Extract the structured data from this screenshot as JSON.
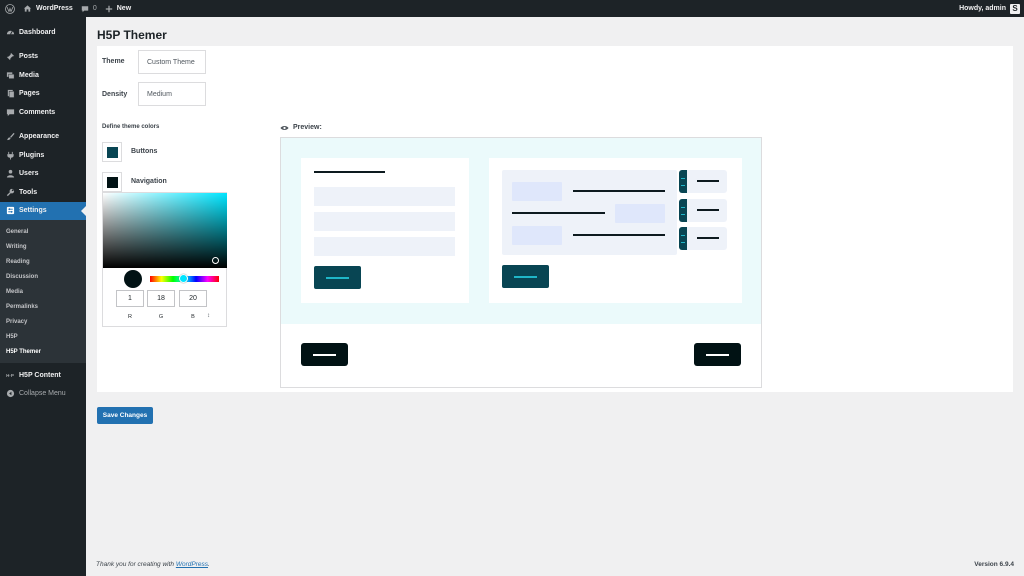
{
  "adminbar": {
    "site_name": "WordPress",
    "comments_count": "0",
    "new_label": "New",
    "howdy": "Howdy, admin",
    "avatar_letter": "S"
  },
  "sidebar": {
    "items": [
      {
        "label": "Dashboard",
        "icon": "dashboard-icon"
      },
      {
        "label": "Posts",
        "icon": "pin-icon"
      },
      {
        "label": "Media",
        "icon": "media-icon"
      },
      {
        "label": "Pages",
        "icon": "page-icon"
      },
      {
        "label": "Comments",
        "icon": "comment-icon"
      },
      {
        "label": "Appearance",
        "icon": "brush-icon"
      },
      {
        "label": "Plugins",
        "icon": "plug-icon"
      },
      {
        "label": "Users",
        "icon": "user-icon"
      },
      {
        "label": "Tools",
        "icon": "wrench-icon"
      },
      {
        "label": "Settings",
        "icon": "settings-icon"
      }
    ],
    "submenu": [
      "General",
      "Writing",
      "Reading",
      "Discussion",
      "Media",
      "Permalinks",
      "Privacy",
      "H5P",
      "H5P Themer"
    ],
    "h5p_content": "H5P Content",
    "h5p_icon_text": "H·P",
    "collapse": "Collapse Menu"
  },
  "page": {
    "title": "H5P Themer",
    "theme_label": "Theme",
    "theme_value": "Custom Theme",
    "density_label": "Density",
    "density_value": "Medium",
    "define_colors": "Define theme colors",
    "buttons_label": "Buttons",
    "navigation_label": "Navigation",
    "preview_label": "Preview:",
    "save_label": "Save Changes"
  },
  "colors": {
    "buttons": "#084553",
    "navigation": "#011214",
    "accent": "#2271b1"
  },
  "picker": {
    "r": "1",
    "g": "18",
    "b": "20",
    "r_label": "R",
    "g_label": "G",
    "b_label": "B",
    "toggle": "↕"
  },
  "footer": {
    "thanks_prefix": "Thank you for creating with ",
    "thanks_link": "WordPress",
    "thanks_suffix": ".",
    "version": "Version 6.9.4"
  }
}
